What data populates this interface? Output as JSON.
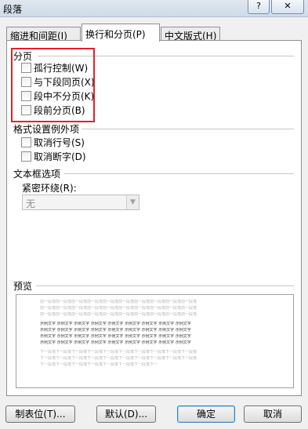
{
  "window": {
    "title": "段落",
    "help_label": "?",
    "close_label": "✕"
  },
  "tabs": [
    {
      "label": "缩进和间距(I)",
      "active": false
    },
    {
      "label": "换行和分页(P)",
      "active": true
    },
    {
      "label": "中文版式(H)",
      "active": false
    }
  ],
  "pagination": {
    "heading": "分页",
    "options": [
      {
        "label": "孤行控制(W)",
        "checked": false
      },
      {
        "label": "与下段同页(X)",
        "checked": false
      },
      {
        "label": "段中不分页(K)",
        "checked": false
      },
      {
        "label": "段前分页(B)",
        "checked": false
      }
    ]
  },
  "format_exceptions": {
    "heading": "格式设置例外项",
    "options": [
      {
        "label": "取消行号(S)",
        "checked": false
      },
      {
        "label": "取消断字(D)",
        "checked": false
      }
    ]
  },
  "textbox": {
    "heading": "文本框选项",
    "wrap_label": "紧密环绕(R):",
    "wrap_value": "无",
    "wrap_enabled": false
  },
  "preview": {
    "heading": "预览",
    "prev_text": "前一段落前一段落前一段落前一段落前一段落前一段落前一段落前一段落前一段落前一段落",
    "sample_text": "示例文字 示例文字 示例文字 示例文字 示例文字 示例文字 示例文字 示例文字 示例文字",
    "next_text": "下一段落下一段落下一段落下一段落下一段落下一段落下一段落下一段落下一段落下一段落"
  },
  "buttons": {
    "tabs": "制表位(T)...",
    "default": "默认(D)...",
    "ok": "确定",
    "cancel": "取消"
  },
  "colors": {
    "highlight_box": "#e3212a",
    "default_button_border": "#3c7fb1"
  }
}
